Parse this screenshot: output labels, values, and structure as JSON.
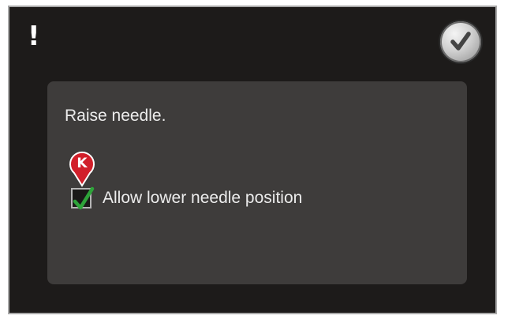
{
  "dialog": {
    "alert_symbol": "!",
    "confirm_icon": "checkmark-icon",
    "message": "Raise needle.",
    "option": {
      "label": "Allow lower needle position",
      "checked": true,
      "check_color": "#2ea43a"
    }
  },
  "annotation": {
    "letter": "K",
    "color": "#d11f2a"
  },
  "colors": {
    "screen_background": "#1d1b1a",
    "panel_background": "#3e3c3b",
    "text": "#ececec"
  }
}
